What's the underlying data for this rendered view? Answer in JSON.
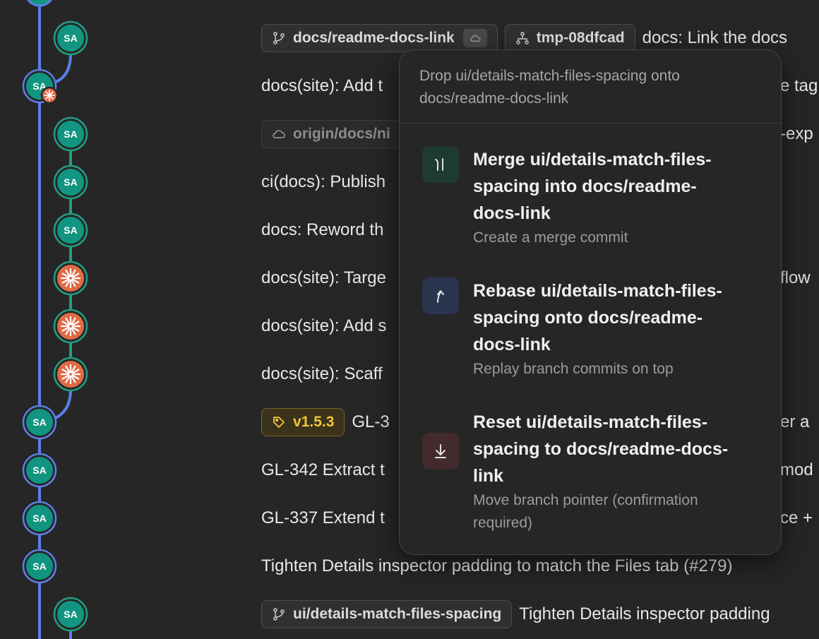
{
  "rows": [
    {
      "chips": [
        {
          "kind": "branch",
          "label": "docs/readme-docs-link",
          "cloud_badge": true
        },
        {
          "kind": "worktree",
          "label": "tmp-08dfcad"
        }
      ],
      "message": "docs: Link the docs"
    },
    {
      "chips": [],
      "message": "docs(site): Add t"
    },
    {
      "chips": [
        {
          "kind": "remote",
          "label": "origin/docs/ni"
        }
      ],
      "message": ""
    },
    {
      "chips": [],
      "message": "ci(docs): Publish"
    },
    {
      "chips": [],
      "message": "docs: Reword th"
    },
    {
      "chips": [],
      "message": "docs(site): Targe"
    },
    {
      "chips": [],
      "message": "docs(site): Add s"
    },
    {
      "chips": [],
      "message": "docs(site): Scaff"
    },
    {
      "chips": [
        {
          "kind": "tag",
          "label": "v1.5.3"
        }
      ],
      "message": "GL-3"
    },
    {
      "chips": [],
      "message": "GL-342 Extract t"
    },
    {
      "chips": [],
      "message": "GL-337 Extend t"
    },
    {
      "chips": [],
      "message": "Tighten Details inspector padding to match the Files tab (#279)"
    },
    {
      "chips": [
        {
          "kind": "branch",
          "label": "ui/details-match-files-spacing"
        }
      ],
      "message": "Tighten Details inspector padding"
    }
  ],
  "right_fragments": [
    {
      "row": 1,
      "text": "e tag"
    },
    {
      "row": 2,
      "text": "-exp"
    },
    {
      "row": 5,
      "text": "flow"
    },
    {
      "row": 8,
      "text": "er a"
    },
    {
      "row": 9,
      "text": "mod"
    },
    {
      "row": 10,
      "text": "ce +"
    }
  ],
  "graph": {
    "avatar_initials": "SA",
    "colors": {
      "main_lane": "#5b7ee8",
      "side_lane": "#1f9f80",
      "avatar": "#119580",
      "claude_avatar": "#e06a45"
    }
  },
  "popover": {
    "header": "Drop ui/details-match-files-spacing onto\ndocs/readme-docs-link",
    "options": [
      {
        "icon": "merge-icon",
        "title": "Merge ui/details-match-files-\nspacing into docs/readme-\ndocs-link",
        "subtitle": "Create a merge commit",
        "tile_color": "#1f3a32"
      },
      {
        "icon": "rebase-icon",
        "title": "Rebase ui/details-match-files-\nspacing onto docs/readme-\ndocs-link",
        "subtitle": "Replay branch commits on top",
        "tile_color": "#2a3550"
      },
      {
        "icon": "reset-icon",
        "title": "Reset ui/details-match-files-\nspacing to docs/readme-docs-\nlink",
        "subtitle": "Move branch pointer (confirmation\nrequired)",
        "tile_color": "#432a2c"
      }
    ]
  }
}
